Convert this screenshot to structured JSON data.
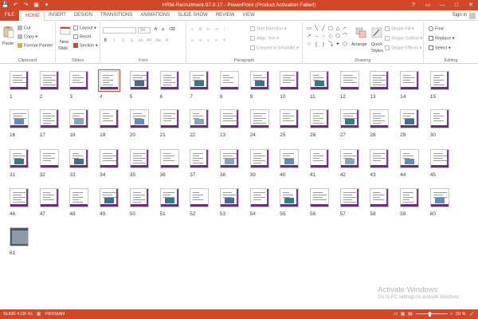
{
  "window": {
    "title": "HRM-Recruitment-97.8.17 - PowerPoint (Product Activation Failed)",
    "controls": [
      "?",
      "▭",
      "—",
      "□",
      "✕"
    ]
  },
  "qat": [
    "💾",
    "↶",
    "↷",
    "▣",
    "▾"
  ],
  "tabs": {
    "file": "FILE",
    "items": [
      "HOME",
      "INSERT",
      "DESIGN",
      "TRANSITIONS",
      "ANIMATIONS",
      "SLIDE SHOW",
      "REVIEW",
      "VIEW"
    ],
    "active": "HOME",
    "signin": "Sign in"
  },
  "ribbon": {
    "clipboard": {
      "label": "Clipboard",
      "paste": "Paste",
      "cut": "Cut",
      "copy": "Copy",
      "format_painter": "Format Painter"
    },
    "slides": {
      "label": "Slides",
      "new_slide": "New",
      "new_slide2": "Slide",
      "layout": "Layout",
      "reset": "Reset",
      "section": "Section"
    },
    "font": {
      "label": "Font",
      "size": "24",
      "format_buttons": [
        "B",
        "I",
        "U",
        "S",
        "ab",
        "AV",
        "Aa",
        "A"
      ]
    },
    "paragraph": {
      "label": "Paragraph",
      "text_direction": "Text Direction",
      "align_text": "Align Text",
      "convert_smartart": "Convert to SmartArt"
    },
    "drawing": {
      "label": "Drawing",
      "arrange": "Arrange",
      "quick_styles": "Quick",
      "quick_styles2": "Styles",
      "shape_fill": "Shape Fill",
      "shape_outline": "Shape Outline",
      "shape_effects": "Shape Effects"
    },
    "editing": {
      "label": "Editing",
      "find": "Find",
      "replace": "Replace",
      "select": "Select"
    }
  },
  "sorter": {
    "selected_slide": 4,
    "slides": [
      "1",
      "2",
      "3",
      "4",
      "5",
      "6",
      "7",
      "8",
      "9",
      "10",
      "11",
      "12",
      "13",
      "14",
      "15",
      "16",
      "17",
      "18",
      "19",
      "20",
      "21",
      "22",
      "23",
      "24",
      "25",
      "26",
      "27",
      "28",
      "29",
      "30",
      "31",
      "32",
      "33",
      "34",
      "35",
      "36",
      "37",
      "38",
      "39",
      "40",
      "41",
      "42",
      "43",
      "44",
      "45",
      "46",
      "47",
      "48",
      "49",
      "50",
      "51",
      "52",
      "53",
      "54",
      "55",
      "56",
      "57",
      "58",
      "59",
      "60",
      "61"
    ]
  },
  "activation": {
    "title": "Activate Windows",
    "subtitle": "Go to PC settings to activate Windows."
  },
  "status": {
    "slide_info": "SLIDE 4 OF 61",
    "language": "PERSIAN",
    "zoom": "20 %",
    "zoom_level": 0.2,
    "accent": "#d24726"
  }
}
